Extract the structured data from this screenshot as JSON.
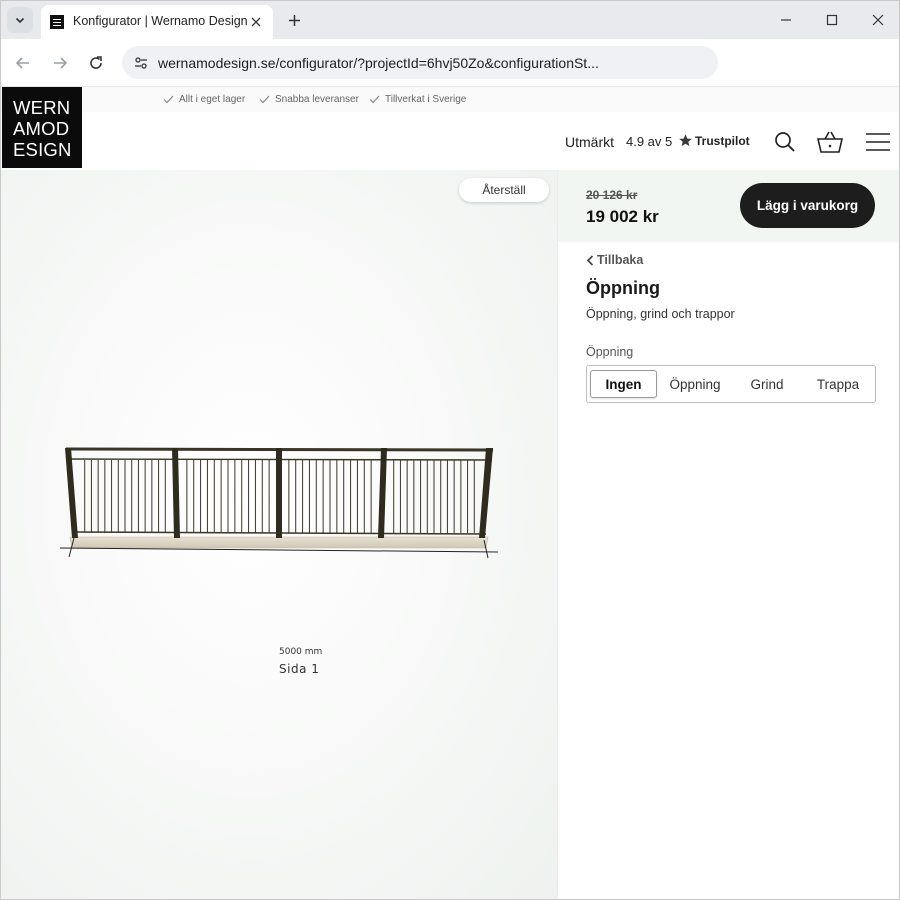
{
  "browser": {
    "tab_title": "Konfigurator | Wernamo Design",
    "url": "wernamodesign.se/configurator/?projectId=6hvj50Zo&configurationSt..."
  },
  "site": {
    "logo_lines": [
      "WERN",
      "AMOD",
      "ESIGN"
    ],
    "usps": [
      "Allt i eget lager",
      "Snabba leveranser",
      "Tillverkat i Sverige"
    ],
    "review": {
      "label": "Utmärkt",
      "score": "4.9 av 5",
      "provider": "Trustpilot"
    }
  },
  "viewport": {
    "reset_label": "Återställ",
    "dimension": "5000 mm",
    "side_label": "Sida 1"
  },
  "panel": {
    "old_price": "20 126 kr",
    "new_price": "19 002 kr",
    "add_to_cart": "Lägg i varukorg",
    "back_label": "Tillbaka",
    "section_title": "Öppning",
    "section_desc": "Öppning, grind och trappor",
    "field_label": "Öppning",
    "options": [
      "Ingen",
      "Öppning",
      "Grind",
      "Trappa"
    ],
    "selected_option": "Ingen"
  },
  "colors": {
    "logo_bg": "#0b0b0b",
    "cart_button": "#1d1d1d",
    "price_bar": "#f1f6f2"
  }
}
